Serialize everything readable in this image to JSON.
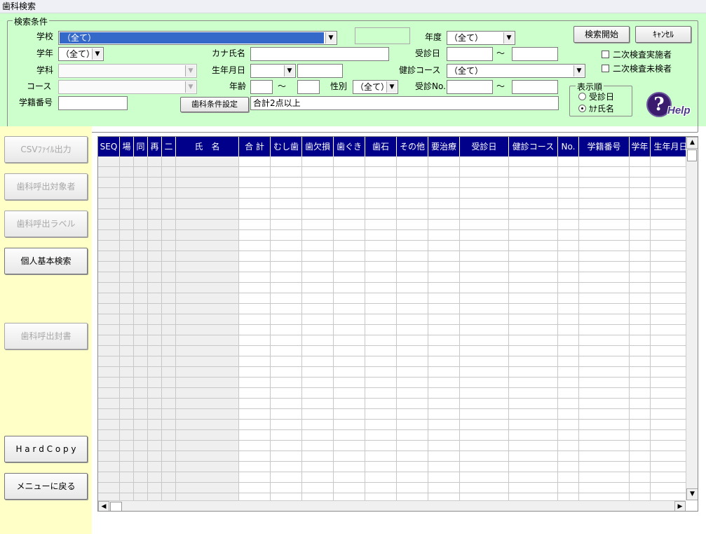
{
  "window": {
    "title": "歯科検索"
  },
  "criteria": {
    "legend": "検索条件",
    "school": {
      "label": "学校",
      "value": "（全て）"
    },
    "grade": {
      "label": "学年",
      "value": "（全て）"
    },
    "department": {
      "label": "学科",
      "value": ""
    },
    "course": {
      "label": "コース",
      "value": ""
    },
    "student_no": {
      "label": "学籍番号",
      "value": ""
    },
    "kana_name": {
      "label": "カナ氏名",
      "value": ""
    },
    "birth_date": {
      "label": "生年月日",
      "value": "",
      "value2": ""
    },
    "age": {
      "label": "年齢",
      "from": "",
      "to": "",
      "tilde": "〜"
    },
    "gender": {
      "label": "性別",
      "value": "（全て）"
    },
    "year": {
      "label": "年度",
      "value": "（全て）"
    },
    "exam_date": {
      "label": "受診日",
      "from": "",
      "to": "",
      "tilde": "〜"
    },
    "checkup_course": {
      "label": "健診コース",
      "value": "（全て）"
    },
    "exam_no": {
      "label": "受診No.",
      "from": "",
      "to": "",
      "tilde": "〜"
    },
    "dental_cond_button": "歯科条件設定",
    "dental_cond_text": "合計2点以上",
    "search_button": "検索開始",
    "cancel_button": "ｷｬﾝｾﾙ",
    "second_done": "二次検査実施者",
    "second_not": "二次検査未検者",
    "sort": {
      "legend": "表示順",
      "option1": "受診日",
      "option2": "ｶﾅ氏名",
      "selected": "ｶﾅ氏名"
    },
    "help": {
      "mark": "?",
      "text": "Help"
    }
  },
  "side": {
    "csv": "CSVﾌｧｲﾙ出力",
    "call_targets": "歯科呼出対象者",
    "call_labels": "歯科呼出ラベル",
    "personal_search": "個人基本検索",
    "call_letter": "歯科呼出封書",
    "hardcopy": "H a r d C o p y",
    "back": "メニューに戻る"
  },
  "grid": {
    "columns": [
      "SEQ",
      "場",
      "同",
      "再",
      "二",
      "氏　名",
      "合 計",
      "むし歯",
      "歯欠損",
      "歯ぐき",
      "歯石",
      "その他",
      "要治療",
      "受診日",
      "健診コース",
      "No.",
      "学籍番号",
      "学年",
      "生年月日"
    ]
  },
  "colors": {
    "panel": "#ccffcc",
    "side": "#ffffc8",
    "grid_header": "#00008b",
    "selection": "#3569c9"
  }
}
